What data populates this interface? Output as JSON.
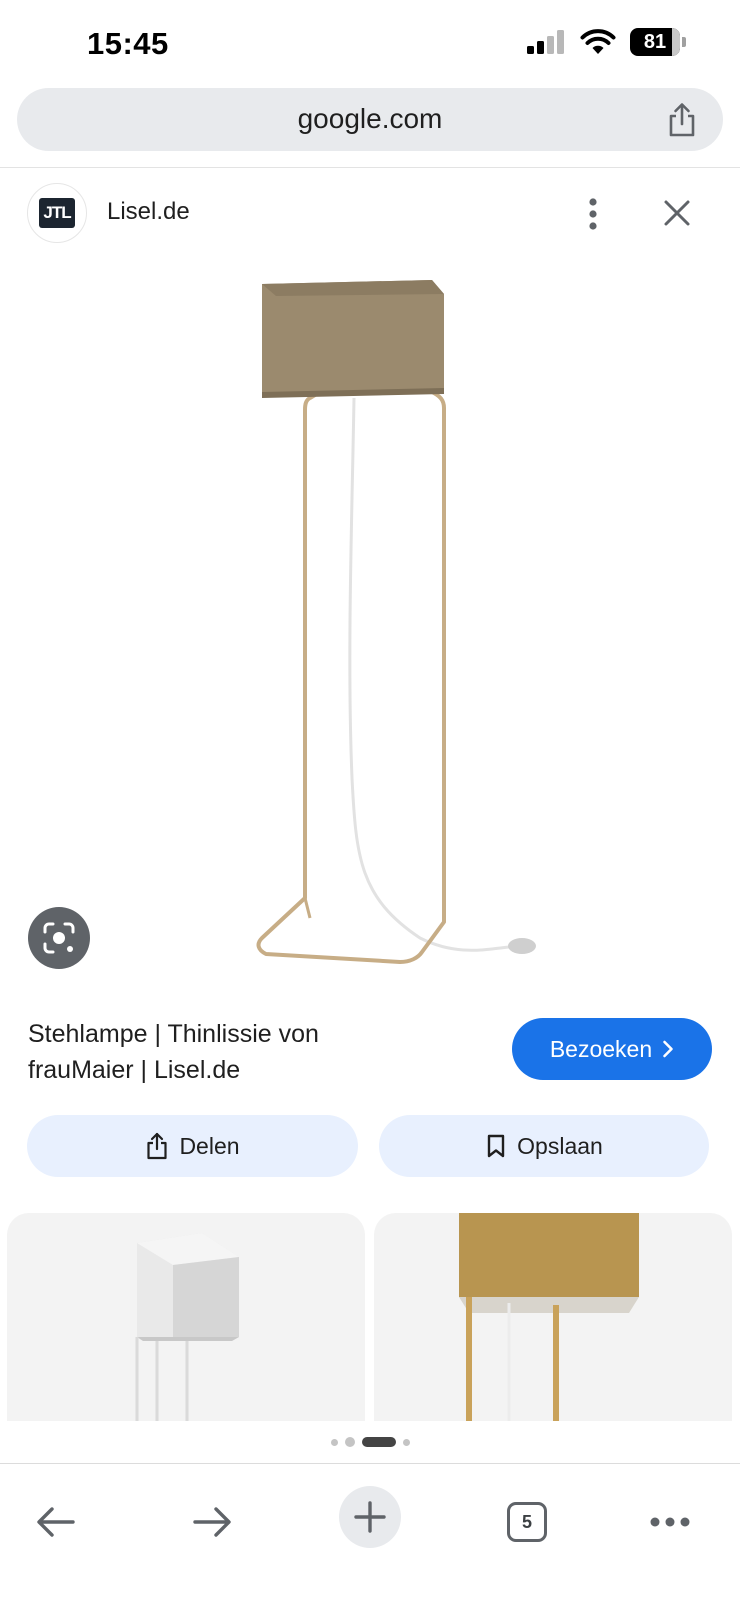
{
  "status_bar": {
    "time": "15:45",
    "battery": "81",
    "icons": [
      "signal-icon",
      "wifi-icon",
      "battery-icon"
    ]
  },
  "address_bar": {
    "url": "google.com",
    "share_icon": "share-icon"
  },
  "site": {
    "logo_text": "JTL",
    "name": "Lisel.de"
  },
  "result": {
    "title": "Stehlampe | Thinlissie von frauMaier | Lisel.de",
    "visit_label": "Bezoeken",
    "share_label": "Delen",
    "save_label": "Opslaan"
  },
  "toolbar": {
    "tab_count": "5"
  },
  "colors": {
    "accent": "#1a73e8",
    "pill_bg": "#e8f0fe",
    "shade": "#9a8a70",
    "frame": "#c2a880"
  }
}
